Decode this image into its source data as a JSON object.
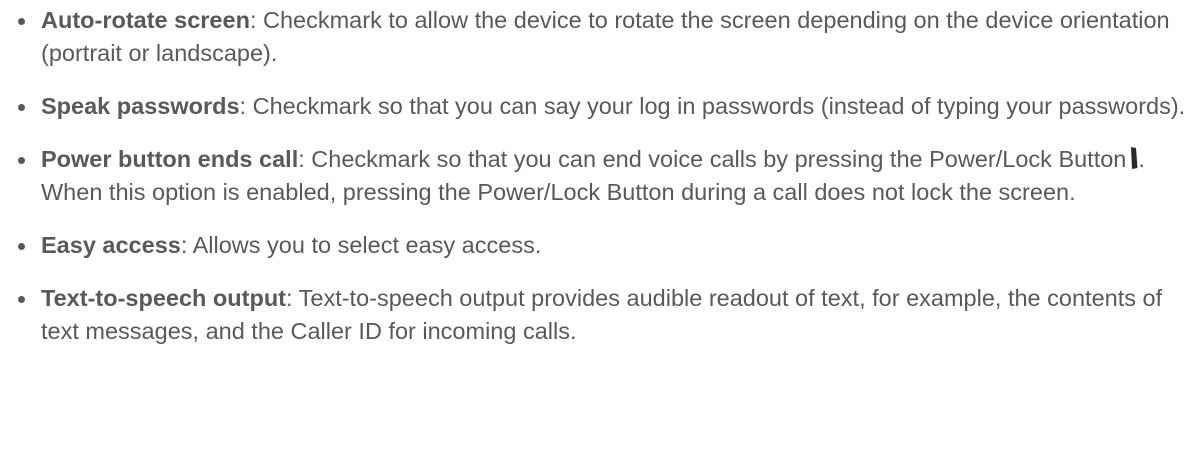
{
  "items": [
    {
      "term": "Auto-rotate screen",
      "text": ": Checkmark to allow the device to rotate the screen depending on the device orientation (portrait or landscape)."
    },
    {
      "term": "Speak passwords",
      "text": ": Checkmark so that you can say your log in passwords (instead of typing your passwords)."
    },
    {
      "term": "Power button ends call",
      "text_before_icon": ": Checkmark so that you can end voice calls by pressing the Power/Lock Button",
      "icon": "power-lock-button-icon",
      "text_after_icon": ". When this option is enabled, pressing the Power/Lock Button during a call does not lock the screen."
    },
    {
      "term": "Easy access",
      "text": ": Allows you to select easy access."
    },
    {
      "term": "Text-to-speech output",
      "text": ": Text-to-speech output provides audible readout of text, for example, the contents of text messages, and the Caller ID for incoming calls."
    }
  ]
}
